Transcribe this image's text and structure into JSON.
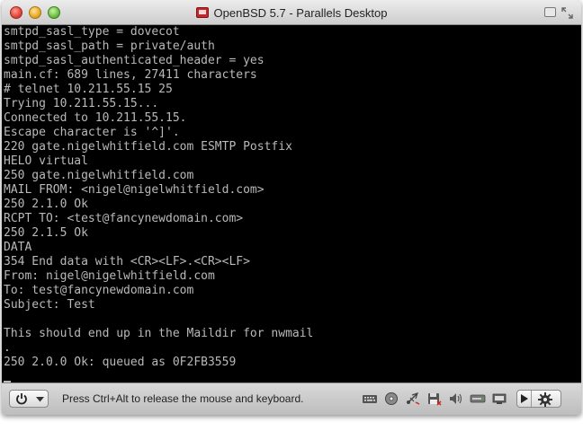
{
  "window": {
    "title": "OpenBSD 5.7 - Parallels Desktop"
  },
  "terminal": {
    "lines": [
      "smtpd_sasl_type = dovecot",
      "smtpd_sasl_path = private/auth",
      "smtpd_sasl_authenticated_header = yes",
      "main.cf: 689 lines, 27411 characters",
      "# telnet 10.211.55.15 25",
      "Trying 10.211.55.15...",
      "Connected to 10.211.55.15.",
      "Escape character is '^]'.",
      "220 gate.nigelwhitfield.com ESMTP Postfix",
      "HELO virtual",
      "250 gate.nigelwhitfield.com",
      "MAIL FROM: <nigel@nigelwhitfield.com>",
      "250 2.1.0 Ok",
      "RCPT TO: <test@fancynewdomain.com>",
      "250 2.1.5 Ok",
      "DATA",
      "354 End data with <CR><LF>.<CR><LF>",
      "From: nigel@nigelwhitfield.com",
      "To: test@fancynewdomain.com",
      "Subject: Test",
      "",
      "This should end up in the Maildir for nwmail",
      ".",
      "250 2.0.0 Ok: queued as 0F2FB3559"
    ]
  },
  "statusbar": {
    "message": "Press Ctrl+Alt to release the mouse and keyboard.",
    "device_icons": [
      "keyboard-icon",
      "cd-drive-icon",
      "usb-icon",
      "floppy-icon",
      "sound-icon",
      "hard-disk-icon",
      "network-icon",
      "shared-folders-icon"
    ]
  },
  "colors": {
    "terminal_background": "#000000",
    "terminal_text": "#b9b9b9"
  }
}
